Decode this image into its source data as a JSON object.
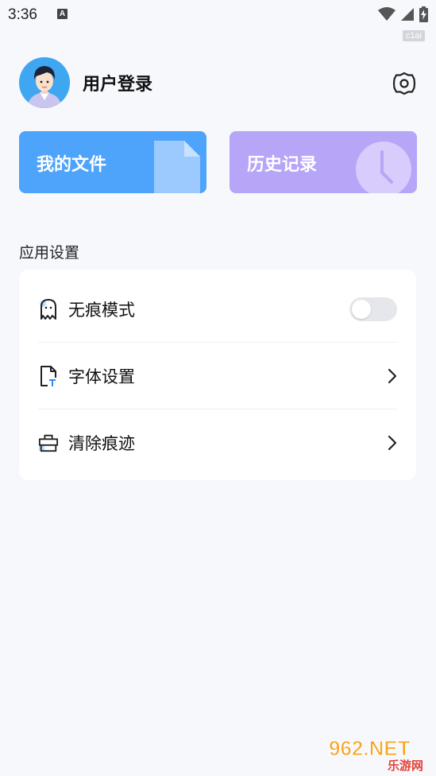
{
  "status_bar": {
    "time": "3:36",
    "notification_badge": "A",
    "icons": [
      "wifi-icon",
      "signal-icon",
      "battery-charging-icon"
    ]
  },
  "watermark_top": "c1ai",
  "profile": {
    "login_label": "用户登录",
    "avatar": "avatar"
  },
  "cards": {
    "files_label": "我的文件",
    "history_label": "历史记录"
  },
  "section_title": "应用设置",
  "settings_list": [
    {
      "label": "无痕模式",
      "icon": "ghost-icon",
      "control": "toggle",
      "enabled": false
    },
    {
      "label": "字体设置",
      "icon": "font-file-icon",
      "control": "chevron"
    },
    {
      "label": "清除痕迹",
      "icon": "toolbox-icon",
      "control": "chevron"
    }
  ],
  "colors": {
    "files_card": "#4ea3fb",
    "history_card": "#b7a5f7",
    "background": "#f7f8fc",
    "toggle_off": "#e6e7ea"
  },
  "watermark_logo": {
    "brand": "962.NET",
    "sub": "乐游网"
  }
}
